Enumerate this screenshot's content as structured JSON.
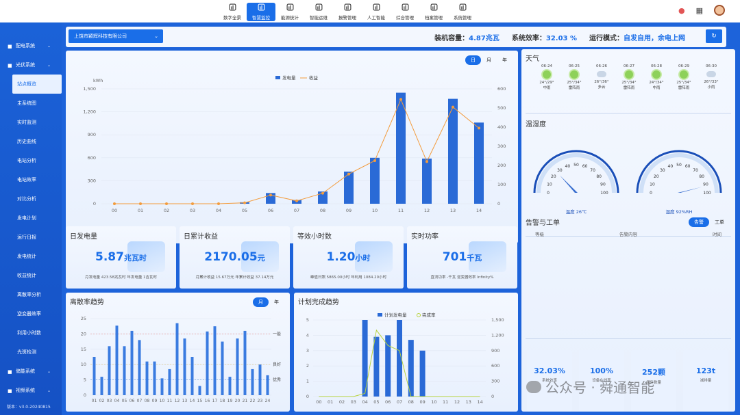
{
  "topnav": [
    {
      "label": "数字全景",
      "icon": "panorama-icon"
    },
    {
      "label": "智慧监控",
      "icon": "bar-chart-icon",
      "active": true
    },
    {
      "label": "能源统计",
      "icon": "stats-icon"
    },
    {
      "label": "智能运维",
      "icon": "gear-icon"
    },
    {
      "label": "报警管理",
      "icon": "alarm-icon"
    },
    {
      "label": "人工智能",
      "icon": "ai-icon"
    },
    {
      "label": "综合管理",
      "icon": "grid-icon"
    },
    {
      "label": "档案管理",
      "icon": "archive-icon"
    },
    {
      "label": "系统管理",
      "icon": "system-icon"
    }
  ],
  "sidebar": {
    "groups": [
      {
        "label": "配电系统",
        "icon": "lightning-icon"
      },
      {
        "label": "光伏系统",
        "icon": "solar-icon"
      }
    ],
    "items": [
      "站点概览",
      "主系统图",
      "实时监测",
      "历史曲线",
      "电站分析",
      "电站效率",
      "对比分析",
      "发电计划",
      "运行日报",
      "发电统计",
      "收益统计",
      "离散率分析",
      "逆变器效率",
      "利用小时数",
      "光斑检测"
    ],
    "bottom_groups": [
      {
        "label": "储能系统",
        "icon": "battery-icon"
      },
      {
        "label": "视频系统",
        "icon": "video-icon"
      }
    ],
    "version": "版本：v3.0-20240815"
  },
  "filter": {
    "company": "上饶市颖辉科技有限公司",
    "capacity_label": "装机容量：",
    "capacity_value": "4.87兆瓦",
    "efficiency_label": "系统效率：",
    "efficiency_value": "32.03 %",
    "mode_label": "运行模式：",
    "mode_value": "自发自用，余电上网"
  },
  "main_chart_tabs": [
    "日",
    "月",
    "年"
  ],
  "chart_data": [
    {
      "type": "bar",
      "categories": [
        "00",
        "01",
        "02",
        "03",
        "04",
        "05",
        "06",
        "07",
        "08",
        "09",
        "10",
        "11",
        "12",
        "13",
        "14"
      ],
      "series": [
        {
          "name": "发电量",
          "values": [
            0,
            0,
            0,
            0,
            0,
            20,
            140,
            50,
            160,
            420,
            600,
            1450,
            590,
            1370,
            1060
          ]
        },
        {
          "name": "收益",
          "values": [
            0,
            0,
            0,
            0,
            0,
            5,
            45,
            15,
            55,
            155,
            225,
            545,
            220,
            505,
            395
          ]
        }
      ],
      "ylabel": "kWh",
      "ylim": [
        0,
        1500
      ],
      "y2lim": [
        0,
        600
      ],
      "yticks": [
        "0",
        "300",
        "600",
        "900",
        "1,200",
        "1,500"
      ],
      "y2ticks": [
        "0",
        "100",
        "200",
        "300",
        "400",
        "500",
        "600"
      ]
    },
    {
      "type": "bar",
      "categories": [
        "01",
        "02",
        "03",
        "04",
        "05",
        "06",
        "07",
        "08",
        "09",
        "10",
        "11",
        "12",
        "13",
        "14",
        "15",
        "16",
        "17",
        "18",
        "19",
        "20",
        "21",
        "22",
        "23",
        "24"
      ],
      "values": [
        12.5,
        6,
        16,
        22.7,
        16,
        21,
        18,
        11,
        11,
        5.5,
        8.5,
        23.5,
        18.5,
        12.5,
        3,
        20.8,
        22.5,
        17.5,
        6,
        18.5,
        21,
        8.5,
        10,
        6.5
      ],
      "ylim": [
        0,
        25
      ],
      "yticks": [
        "0",
        "5",
        "10",
        "15",
        "20",
        "25"
      ],
      "thresholds": [
        "一般",
        "良好",
        "优秀"
      ]
    },
    {
      "type": "bar",
      "categories": [
        "00",
        "01",
        "02",
        "03",
        "04",
        "05",
        "06",
        "07",
        "08",
        "09",
        "10",
        "11",
        "12",
        "13",
        "14"
      ],
      "series": [
        {
          "name": "计划发电量",
          "values": [
            0,
            0,
            0,
            0,
            5,
            3.9,
            4,
            5,
            3.7,
            3,
            0,
            0,
            0,
            0,
            0
          ]
        },
        {
          "name": "完成率",
          "values": [
            0,
            0,
            0,
            0,
            60,
            1300,
            1000,
            900,
            0,
            0,
            0,
            0,
            0,
            0,
            0
          ]
        }
      ],
      "ylim": [
        0,
        5
      ],
      "y2lim": [
        0,
        1500
      ],
      "yticks": [
        "0",
        "1",
        "2",
        "3",
        "4",
        "5"
      ],
      "y2ticks": [
        "0",
        "300",
        "600",
        "900",
        "1,200",
        "1,500"
      ]
    }
  ],
  "cards": [
    {
      "title": "日发电量",
      "value": "5.87",
      "unit": "兆瓦时",
      "sub": "月发电量 423.58兆瓦时  年发电量 1吉瓦时"
    },
    {
      "title": "日累计收益",
      "value": "2170.05",
      "unit": "元",
      "sub": "月累计收益 15.67万元    年累计收益 37.14万元"
    },
    {
      "title": "等效小时数",
      "value": "1.20",
      "unit": "小时",
      "sub": "峰值日照 5865.00小时    年利用 1084.20小时"
    },
    {
      "title": "实时功率",
      "value": "701",
      "unit": "千瓦",
      "sub": "直流功率 -千瓦          逆变器效率 Infinity%"
    }
  ],
  "discrete": {
    "title": "离散率趋势",
    "tabs": [
      "月",
      "年"
    ]
  },
  "plan": {
    "title": "计划完成趋势"
  },
  "weather": {
    "title": "天气",
    "days": [
      {
        "date": "06-24",
        "temp": "24°/29°",
        "desc": "中雨",
        "icon": "rain-sun-icon"
      },
      {
        "date": "06-25",
        "temp": "25°/34°",
        "desc": "雷阵雨",
        "icon": "storm-sun-icon"
      },
      {
        "date": "06-26",
        "temp": "26°/36°",
        "desc": "多云",
        "icon": "cloud-icon"
      },
      {
        "date": "06-27",
        "temp": "25°/34°",
        "desc": "雷阵雨",
        "icon": "storm-sun-icon"
      },
      {
        "date": "06-28",
        "temp": "24°/34°",
        "desc": "中雨",
        "icon": "rain-sun-icon"
      },
      {
        "date": "06-29",
        "temp": "25°/34°",
        "desc": "雷阵雨",
        "icon": "storm-sun-icon"
      },
      {
        "date": "06-30",
        "temp": "26°/33°",
        "desc": "小雨",
        "icon": "rain-cloud-icon"
      }
    ]
  },
  "humidity": {
    "title": "温湿度",
    "temp_label": "温度 26℃",
    "humidity_label": "湿度 92%RH",
    "temp_value": 26,
    "humidity_value": 92,
    "ticks": [
      "0",
      "10",
      "20",
      "30",
      "40",
      "50",
      "60",
      "70",
      "80",
      "90",
      "100"
    ]
  },
  "alarm": {
    "title": "告警与工单",
    "tabs": [
      "告警",
      "工单"
    ],
    "columns": [
      "等级",
      "告警内容",
      "时间"
    ]
  },
  "kpis": [
    {
      "value": "32.03%",
      "label": "系统效率"
    },
    {
      "value": "100%",
      "label": "设备在线率"
    },
    {
      "value": "252颗",
      "label": "组件数量"
    },
    {
      "value": "123t",
      "label": "减排量"
    }
  ],
  "watermark": "公众号 · 舜通智能"
}
